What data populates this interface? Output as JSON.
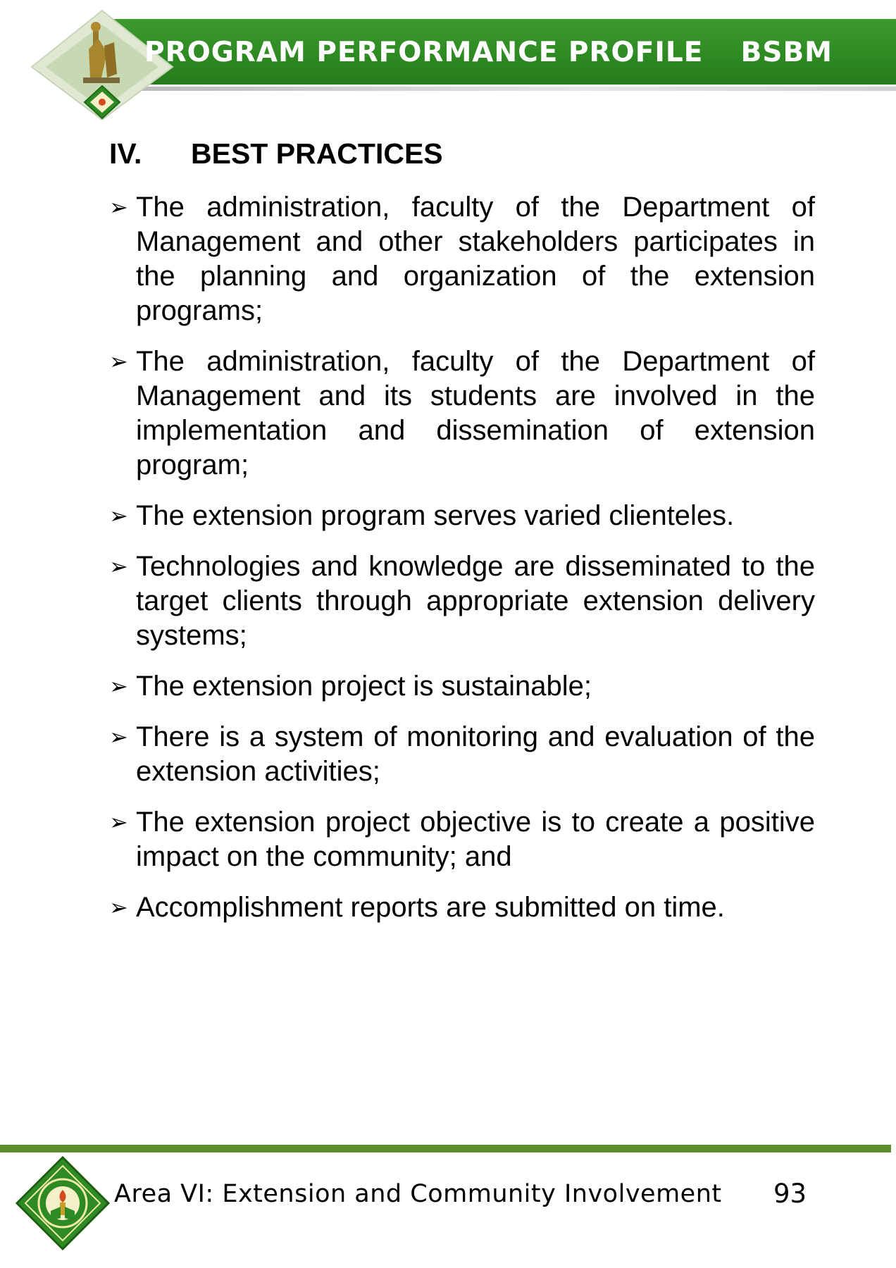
{
  "header": {
    "title": "PROGRAM PERFORMANCE PROFILE",
    "program_code": "BSBM"
  },
  "section": {
    "number": "IV.",
    "title": "BEST PRACTICES"
  },
  "bullets": [
    "The administration, faculty of the Department of Management and other stakeholders participates in the planning and organization of the extension programs;",
    "The administration, faculty of the Department of Management and its students are involved in the implementation and dissemination of extension program;",
    "The extension program serves varied clienteles.",
    "Technologies and knowledge are disseminated to the target clients through appropriate extension delivery systems;",
    "The extension project is sustainable;",
    "There is a system of monitoring and evaluation of the extension activities;",
    "The extension project objective is to create a positive impact on the community; and",
    "Accomplishment reports are submitted on time."
  ],
  "bullet_icon": "arrowhead-bullet-icon",
  "footer": {
    "area_label": "Area VI: Extension and Community Involvement",
    "page_number": "93"
  },
  "colors": {
    "header_green": "#2e8a22",
    "footer_rule": "#5d8c2c"
  }
}
